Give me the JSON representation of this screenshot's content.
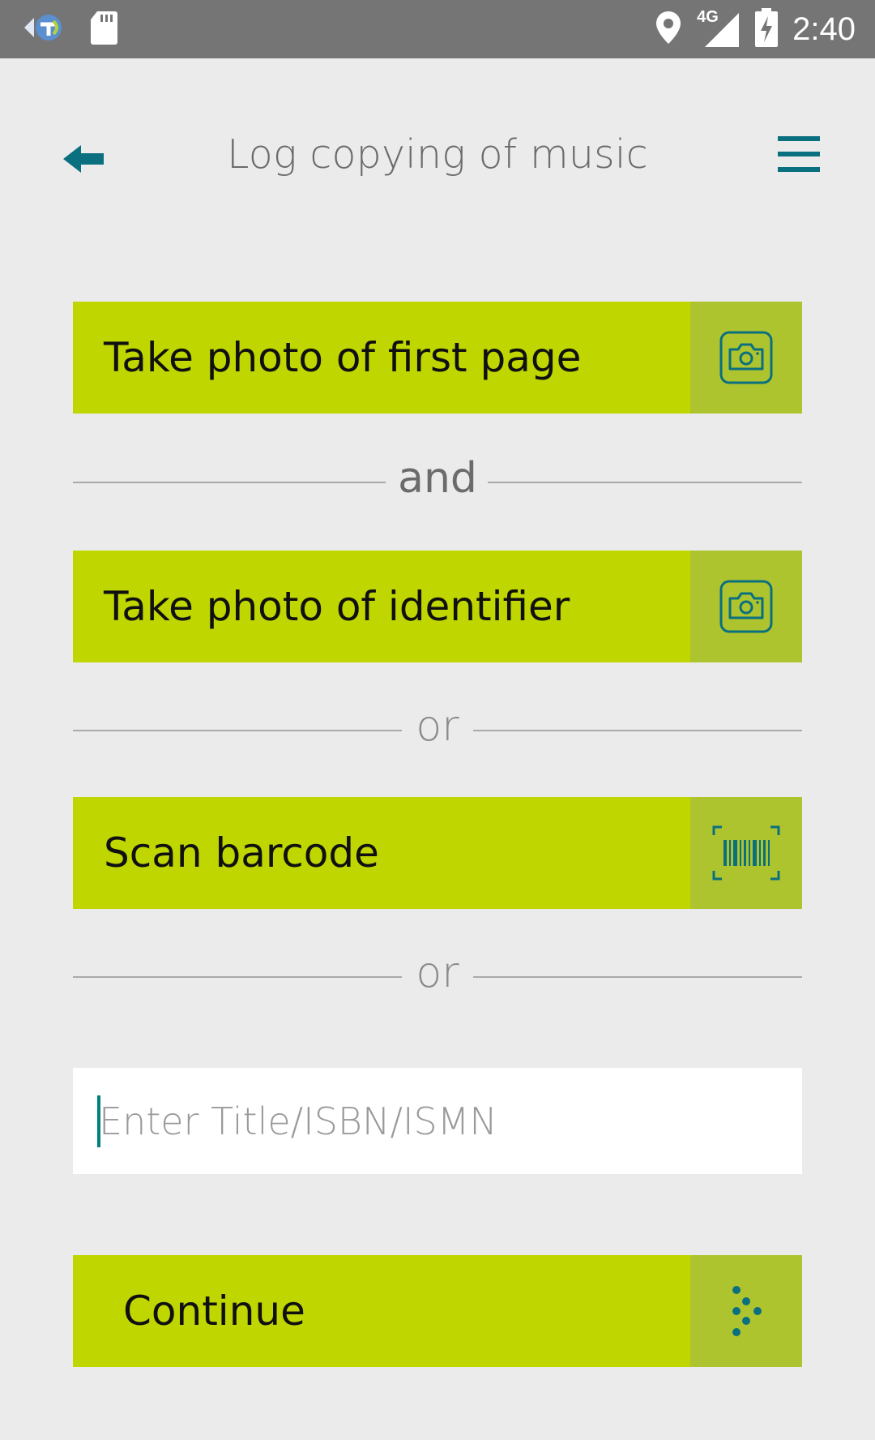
{
  "status_bar": {
    "time": "2:40",
    "network": "4G",
    "icons": [
      "app-notification-icon",
      "sd-card-icon",
      "location-icon",
      "signal-icon",
      "battery-charging-icon"
    ]
  },
  "header": {
    "title": "Log copying of music",
    "back_icon": "back-arrow-icon",
    "menu_icon": "hamburger-menu-icon"
  },
  "actions": {
    "photo_first_page": {
      "label": "Take photo of first page",
      "icon": "camera-icon"
    },
    "photo_identifier": {
      "label": "Take photo of identifier",
      "icon": "camera-icon"
    },
    "scan_barcode": {
      "label": "Scan barcode",
      "icon": "barcode-icon"
    },
    "continue": {
      "label": "Continue",
      "icon": "dots-arrow-icon"
    }
  },
  "separators": {
    "first": "and",
    "second": "or",
    "third": "or"
  },
  "search": {
    "value": "",
    "placeholder": "Enter Title/ISBN/ISMN"
  },
  "colors": {
    "accent": "#bfd600",
    "accent_dark": "#aec42e",
    "icon": "#0a6f7f",
    "status_bar": "#757575",
    "background": "#ebebeb"
  }
}
